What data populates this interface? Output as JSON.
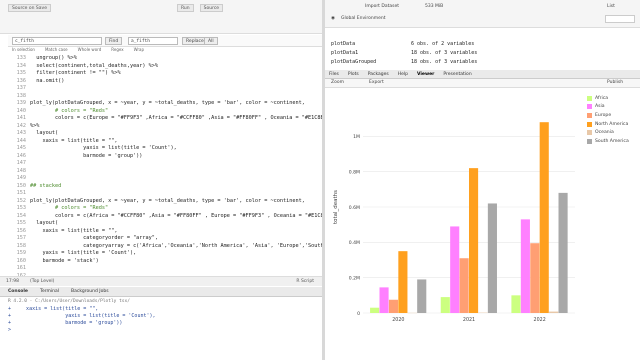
{
  "editor": {
    "tab_buttons": [
      "Source on Save",
      "Run",
      "Source"
    ],
    "search": {
      "find_value": "c_fifth",
      "replace_value": "a_fifth",
      "find_button": "Find",
      "prev_button": "Prev",
      "next_button": "Next",
      "replace_button": "Replace",
      "all_button": "All"
    },
    "options": [
      "In selection",
      "Match case",
      "Whole word",
      "Regex",
      "Wrap"
    ],
    "lines": [
      {
        "n": "133",
        "text": "  ungroup() %>%"
      },
      {
        "n": "134",
        "text": "  select(continent,total_deaths,year) %>%"
      },
      {
        "n": "135",
        "text": "  filter(continent != \"\") %>%"
      },
      {
        "n": "136",
        "text": "  na.omit()"
      },
      {
        "n": "137",
        "text": ""
      },
      {
        "n": "138",
        "text": ""
      },
      {
        "n": "139",
        "text": "plot_ly(plotDataGrouped, x = ~year, y = ~total_deaths, type = 'bar', color = ~continent,"
      },
      {
        "n": "140",
        "text": "        # colors = \"Reds\""
      },
      {
        "n": "141",
        "text": "        colors = c(Europe = \"#FF9F3\" ,Africa = \"#CCFF80\" ,Asia = \"#FF80FF\" , Oceania = \"#E1C8B0\","
      },
      {
        "n": "142",
        "text": "%>%"
      },
      {
        "n": "143",
        "text": "  layout("
      },
      {
        "n": "144",
        "text": "    xaxis = list(title = \"\","
      },
      {
        "n": "145",
        "text": "                 yaxis = list(title = 'Count'),"
      },
      {
        "n": "146",
        "text": "                 barmode = 'group'))"
      },
      {
        "n": "147",
        "text": ""
      },
      {
        "n": "148",
        "text": ""
      },
      {
        "n": "149",
        "text": ""
      },
      {
        "n": "150",
        "text": "## stacked"
      },
      {
        "n": "151",
        "text": ""
      },
      {
        "n": "152",
        "text": "plot_ly(plotDataGrouped, x = ~year, y = ~total_deaths, type = 'bar', color = ~continent,"
      },
      {
        "n": "153",
        "text": "        # colors = \"Reds\""
      },
      {
        "n": "154",
        "text": "        colors = c(Africa = \"#CCFF80\" ,Asia = \"#FF80FF\" , Europe = \"#FF9F3\" , Oceania = \"#E1C8B0\","
      },
      {
        "n": "155",
        "text": "  layout("
      },
      {
        "n": "156",
        "text": "    xaxis = list(title = \"\","
      },
      {
        "n": "157",
        "text": "                 categoryorder = \"array\","
      },
      {
        "n": "158",
        "text": "                 categoryarray = c('Africa','Oceania','North America', 'Asia', 'Europe','South"
      },
      {
        "n": "159",
        "text": "    yaxis = list(title = 'Count'),"
      },
      {
        "n": "160",
        "text": "    barmode = 'stack')"
      },
      {
        "n": "161",
        "text": ""
      },
      {
        "n": "162",
        "text": ""
      },
      {
        "n": "163",
        "text": ""
      },
      {
        "n": "164",
        "text": ""
      },
      {
        "n": "165",
        "text": ""
      },
      {
        "n": "166",
        "text": ""
      },
      {
        "n": "167",
        "text": ""
      },
      {
        "n": "168",
        "text": ""
      }
    ],
    "status_position": "17:98",
    "status_scope": "(Top Level)",
    "status_type": "R Script"
  },
  "console": {
    "tabs": [
      "Console",
      "Terminal",
      "Background Jobs"
    ],
    "path": "R 4.2.0 · C:/Users/User/Downloads/Plotly tsx/",
    "lines": [
      "+     xaxis = list(title = \"\",",
      "+                  yaxis = list(title = 'Count'),",
      "+                  barmode = 'group'))",
      ">"
    ]
  },
  "environment": {
    "toolbar": [
      "Import Dataset",
      "533 MiB",
      "List"
    ],
    "scope": "Global Environment",
    "rows": [
      {
        "name": "plotData",
        "value": "6 obs. of 2 variables"
      },
      {
        "name": "plotData1",
        "value": "18 obs. of 3 variables"
      },
      {
        "name": "plotDataGrouped",
        "value": "18 obs. of 3 variables"
      }
    ]
  },
  "viewer": {
    "tabs": [
      "Files",
      "Plots",
      "Packages",
      "Help",
      "Viewer",
      "Presentation"
    ],
    "active_tab": "Viewer",
    "zoom_label": "Zoom",
    "export_label": "Export",
    "publish_label": "Publish"
  },
  "chart_data": {
    "type": "bar",
    "barmode": "group",
    "categories": [
      "2020",
      "2021",
      "2022"
    ],
    "ylabel": "total_deaths",
    "ylim": [
      0,
      1200000
    ],
    "yticks": [
      "0",
      "0.2M",
      "0.4M",
      "0.6M",
      "0.8M",
      "1M"
    ],
    "ytick_values": [
      0,
      200000,
      400000,
      600000,
      800000,
      1000000
    ],
    "series": [
      {
        "name": "Africa",
        "color": "#CCFF80",
        "values": [
          30000,
          90000,
          100000
        ]
      },
      {
        "name": "Asia",
        "color": "#FF80FF",
        "values": [
          145000,
          490000,
          530000
        ]
      },
      {
        "name": "Europe",
        "color": "#FF9F73",
        "values": [
          75000,
          310000,
          395000
        ]
      },
      {
        "name": "North America",
        "color": "#FFA01E",
        "values": [
          350000,
          820000,
          1080000
        ]
      },
      {
        "name": "Oceania",
        "color": "#E8C8A8",
        "values": [
          1000,
          2000,
          8000
        ]
      },
      {
        "name": "South America",
        "color": "#A8A8A8",
        "values": [
          190000,
          620000,
          680000
        ]
      }
    ],
    "legend_position": "top-right",
    "grid": true
  }
}
